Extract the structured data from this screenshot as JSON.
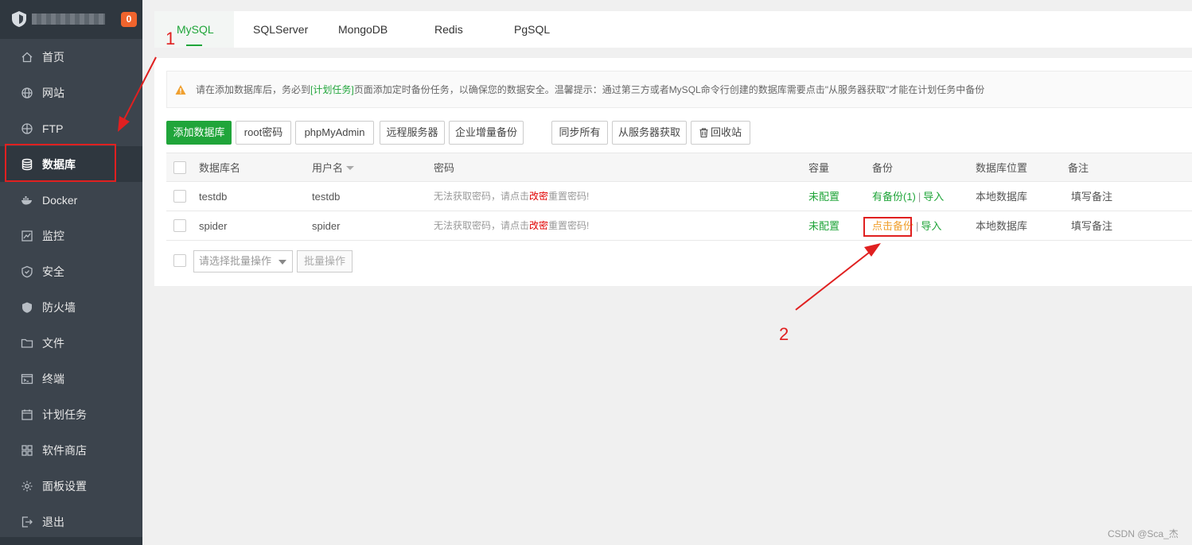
{
  "sidebar": {
    "badge": "0",
    "items": [
      {
        "label": "首页",
        "icon": "home-icon"
      },
      {
        "label": "网站",
        "icon": "globe-icon"
      },
      {
        "label": "FTP",
        "icon": "ftp-icon"
      },
      {
        "label": "数据库",
        "icon": "database-icon",
        "active": true
      },
      {
        "label": "Docker",
        "icon": "docker-icon"
      },
      {
        "label": "监控",
        "icon": "monitor-icon"
      },
      {
        "label": "安全",
        "icon": "shield-icon"
      },
      {
        "label": "防火墙",
        "icon": "firewall-icon"
      },
      {
        "label": "文件",
        "icon": "folder-icon"
      },
      {
        "label": "终端",
        "icon": "terminal-icon"
      },
      {
        "label": "计划任务",
        "icon": "cron-icon"
      },
      {
        "label": "软件商店",
        "icon": "apps-icon"
      },
      {
        "label": "面板设置",
        "icon": "gear-icon"
      },
      {
        "label": "退出",
        "icon": "logout-icon"
      }
    ]
  },
  "tabs": [
    "MySQL",
    "SQLServer",
    "MongoDB",
    "Redis",
    "PgSQL"
  ],
  "tip": {
    "before": "请在添加数据库后，务必到",
    "link": "[计划任务]",
    "after": "页面添加定时备份任务，以确保您的数据安全。温馨提示：通过第三方或者MySQL命令行创建的数据库需要点击\"从服务器获取\"才能在计划任务中备份"
  },
  "toolbar": {
    "add": "添加数据库",
    "root": "root密码",
    "pma": "phpMyAdmin",
    "remote": "远程服务器",
    "incremental": "企业增量备份",
    "sync": "同步所有",
    "fetch": "从服务器获取",
    "recycle": "回收站"
  },
  "table": {
    "headers": {
      "name": "数据库名",
      "user": "用户名",
      "password": "密码",
      "capacity": "容量",
      "backup": "备份",
      "location": "数据库位置",
      "note": "备注"
    },
    "rows": [
      {
        "name": "testdb",
        "user": "testdb",
        "pw_before": "无法获取密码，请点击",
        "pw_link": "改密",
        "pw_after": "重置密码!",
        "capacity": "未配置",
        "backup": "有备份(1)",
        "sep": "|",
        "import": "导入",
        "location": "本地数据库",
        "note": "填写备注"
      },
      {
        "name": "spider",
        "user": "spider",
        "pw_before": "无法获取密码，请点击",
        "pw_link": "改密",
        "pw_after": "重置密码!",
        "capacity": "未配置",
        "backup": "点击备份",
        "sep": "|",
        "import": "导入",
        "location": "本地数据库",
        "note": "填写备注"
      }
    ]
  },
  "batch": {
    "placeholder": "请选择批量操作",
    "button": "批量操作"
  },
  "annotations": {
    "one": "1",
    "two": "2"
  },
  "watermark": "CSDN @Sca_杰",
  "colors": {
    "accent": "#20a53a",
    "sidebar": "#3c444d",
    "annotation": "#e02020",
    "warning": "#f0a030"
  }
}
